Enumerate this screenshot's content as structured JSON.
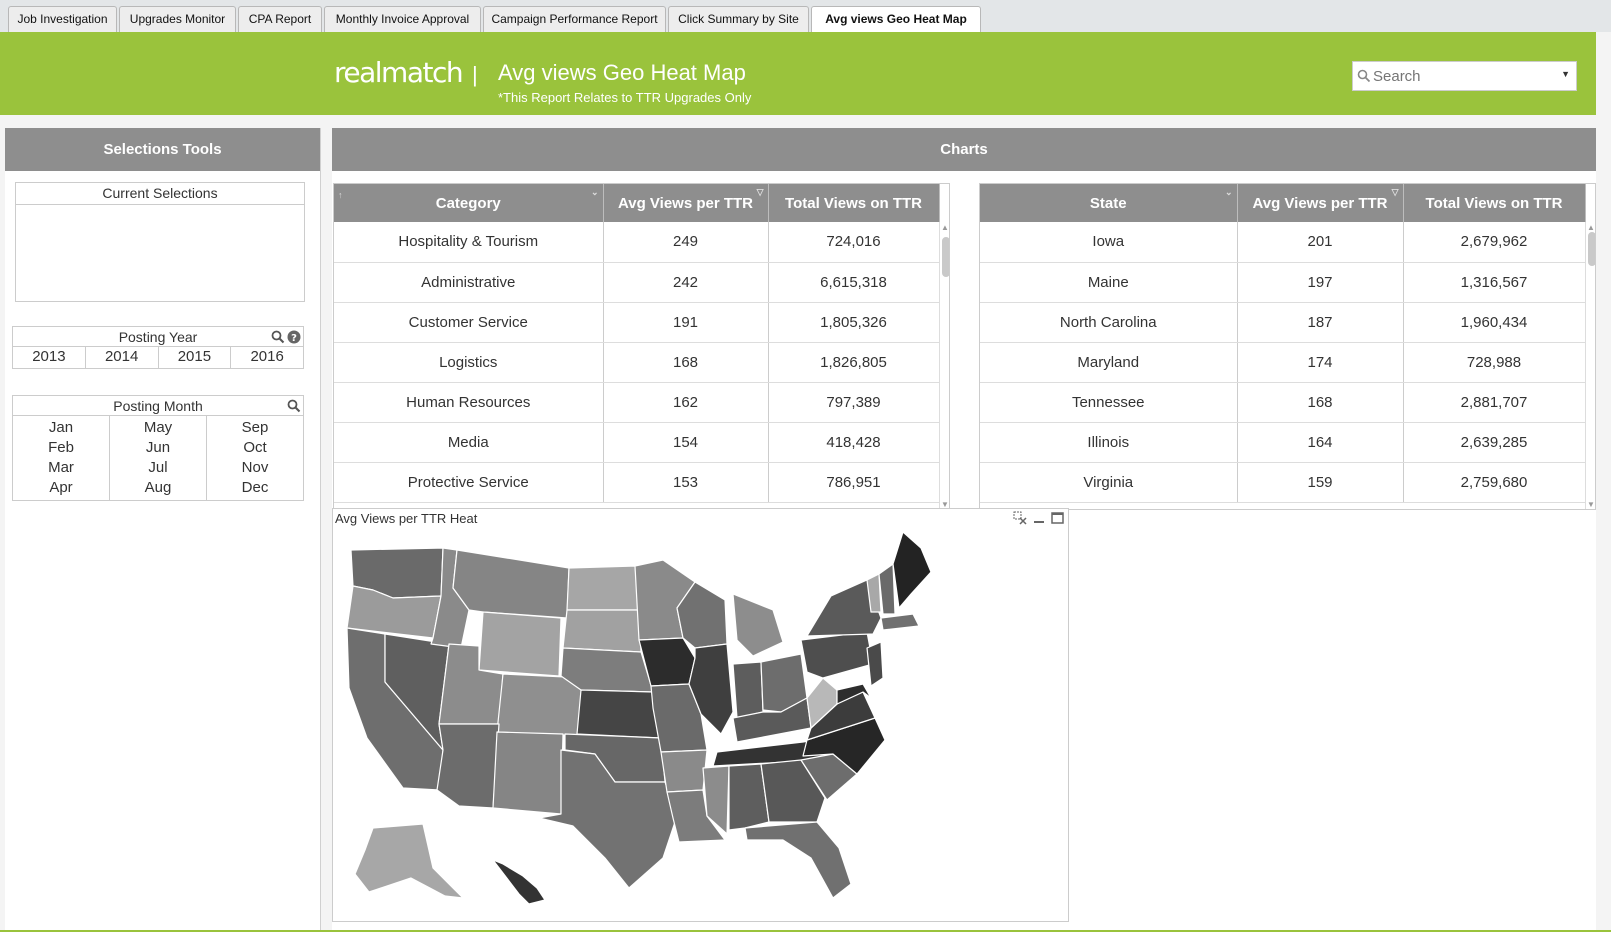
{
  "tabs": [
    {
      "label": "Job Investigation",
      "active": false
    },
    {
      "label": "Upgrades Monitor",
      "active": false
    },
    {
      "label": "CPA Report",
      "active": false
    },
    {
      "label": "Monthly Invoice Approval",
      "active": false
    },
    {
      "label": "Campaign Performance Report",
      "active": false
    },
    {
      "label": "Click Summary by Site",
      "active": false
    },
    {
      "label": "Avg views Geo Heat Map",
      "active": true
    }
  ],
  "banner": {
    "logo": "realmatch",
    "separator": "|",
    "title": "Avg views Geo Heat Map",
    "subtitle": "*This Report Relates to TTR Upgrades Only",
    "search_placeholder": "Search",
    "color": "#9ac33c"
  },
  "left_panel": {
    "title": "Selections Tools",
    "current_selections_label": "Current Selections",
    "posting_year": {
      "label": "Posting Year",
      "values": [
        "2013",
        "2014",
        "2015",
        "2016"
      ]
    },
    "posting_month": {
      "label": "Posting Month",
      "columns": [
        [
          "Jan",
          "Feb",
          "Mar",
          "Apr"
        ],
        [
          "May",
          "Jun",
          "Jul",
          "Aug"
        ],
        [
          "Sep",
          "Oct",
          "Nov",
          "Dec"
        ]
      ]
    }
  },
  "charts_panel": {
    "title": "Charts",
    "category_table": {
      "headers": [
        "Category",
        "Avg Views per TTR",
        "Total Views on TTR"
      ],
      "rows": [
        [
          "Hospitality & Tourism",
          "249",
          "724,016"
        ],
        [
          "Administrative",
          "242",
          "6,615,318"
        ],
        [
          "Customer Service",
          "191",
          "1,805,326"
        ],
        [
          "Logistics",
          "168",
          "1,826,805"
        ],
        [
          "Human Resources",
          "162",
          "797,389"
        ],
        [
          "Media",
          "154",
          "418,428"
        ],
        [
          "Protective Service",
          "153",
          "786,951"
        ]
      ]
    },
    "state_table": {
      "headers": [
        "State",
        "Avg Views per TTR",
        "Total Views on TTR"
      ],
      "rows": [
        [
          "Iowa",
          "201",
          "2,679,962"
        ],
        [
          "Maine",
          "197",
          "1,316,567"
        ],
        [
          "North Carolina",
          "187",
          "1,960,434"
        ],
        [
          "Maryland",
          "174",
          "728,988"
        ],
        [
          "Tennessee",
          "168",
          "2,881,707"
        ],
        [
          "Illinois",
          "164",
          "2,639,285"
        ],
        [
          "Virginia",
          "159",
          "2,759,680"
        ]
      ]
    },
    "map": {
      "title": "Avg Views per TTR Heat"
    }
  },
  "colors": {
    "header_gray": "#8e8e8e",
    "accent_green": "#9ac33c"
  }
}
